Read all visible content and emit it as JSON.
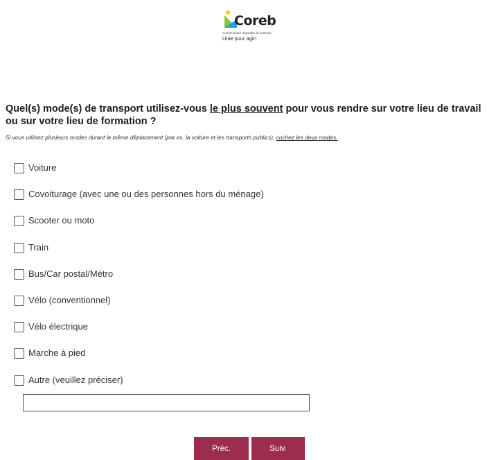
{
  "logo": {
    "name": "Coreb",
    "small_text": "Communauté régionale de la Broye",
    "tagline": "Unie pour agir!",
    "colors": {
      "yellow": "#f2d21b",
      "green": "#8cc63f",
      "blue": "#1fa3de"
    }
  },
  "question": {
    "title_part1": "Quel(s) mode(s) de transport utilisez-vous ",
    "title_emphasis": "le plus souvent",
    "title_part2": " pour vous rendre sur votre lieu de travail ou sur votre lieu de formation ?",
    "hint_part1": "Si vous utilisez plusieurs modes durant le même déplacement (par ex. la voiture et les transports publics), ",
    "hint_emphasis": "cochez les deux modes."
  },
  "options": [
    {
      "label": "Voiture",
      "checked": false
    },
    {
      "label": "Covoiturage (avec une ou des personnes hors du ménage)",
      "checked": false
    },
    {
      "label": "Scooter ou moto",
      "checked": false
    },
    {
      "label": "Train",
      "checked": false
    },
    {
      "label": "Bus/Car postal/Métro",
      "checked": false
    },
    {
      "label": "Vélo (conventionnel)",
      "checked": false
    },
    {
      "label": "Vélo électrique",
      "checked": false
    },
    {
      "label": "Marche à pied",
      "checked": false
    },
    {
      "label": "Autre (veuillez préciser)",
      "checked": false
    }
  ],
  "other_input": {
    "value": "",
    "placeholder": ""
  },
  "nav": {
    "prev_label": "Préc.",
    "next_label": "Suiv.",
    "button_color": "#9c2d4e"
  }
}
